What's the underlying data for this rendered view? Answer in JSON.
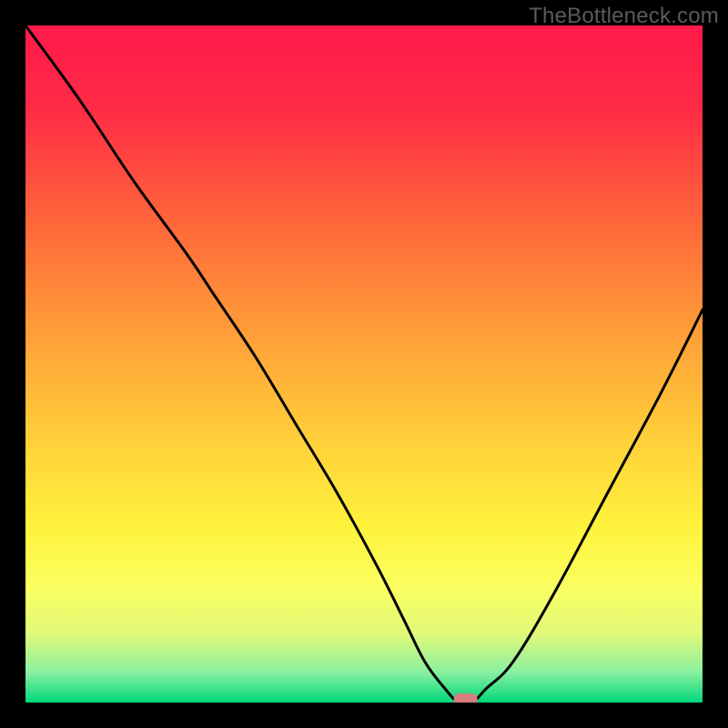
{
  "watermark": "TheBottleneck.com",
  "colors": {
    "frame": "#000000",
    "curve": "#000000",
    "marker_fill": "#d77d7d",
    "gradient_stops": [
      {
        "offset": 0.0,
        "color": "#ff1a4b"
      },
      {
        "offset": 0.12,
        "color": "#ff2a46"
      },
      {
        "offset": 0.3,
        "color": "#ff6a3a"
      },
      {
        "offset": 0.48,
        "color": "#ffa638"
      },
      {
        "offset": 0.62,
        "color": "#ffd23a"
      },
      {
        "offset": 0.74,
        "color": "#fff23c"
      },
      {
        "offset": 0.83,
        "color": "#fbff60"
      },
      {
        "offset": 0.9,
        "color": "#dff97a"
      },
      {
        "offset": 0.955,
        "color": "#8af0a0"
      },
      {
        "offset": 1.0,
        "color": "#00d77a"
      }
    ]
  },
  "chart_data": {
    "type": "line",
    "title": "",
    "xlabel": "",
    "ylabel": "",
    "xlim": [
      0,
      100
    ],
    "ylim": [
      0,
      100
    ],
    "series": [
      {
        "name": "bottleneck-curve",
        "x": [
          0,
          8,
          16,
          24,
          28,
          34,
          40,
          46,
          52,
          56,
          59,
          62,
          64,
          66,
          68,
          72,
          78,
          86,
          94,
          100
        ],
        "y": [
          100,
          89,
          77,
          66,
          60,
          51,
          41,
          31,
          20,
          12,
          6,
          2,
          0,
          0,
          2,
          6,
          16,
          31,
          46,
          58
        ]
      }
    ],
    "marker": {
      "x": 65,
      "y": 0,
      "shape": "rounded-rect"
    },
    "background": "vertical-gradient-rainbow"
  }
}
